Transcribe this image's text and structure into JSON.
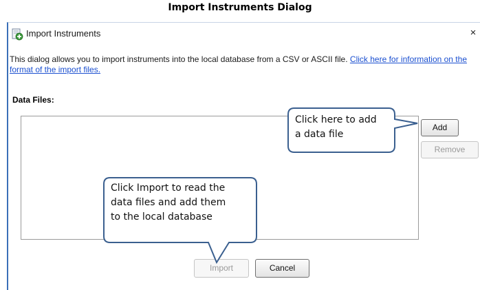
{
  "caption": "Import Instruments Dialog",
  "dialog": {
    "title": "Import Instruments",
    "close_glyph": "×",
    "description": "This dialog allows you to import instruments into the local database from a CSV or ASCII file.",
    "format_link": "Click here for information on the format of the import files.",
    "data_files_label": "Data Files:",
    "buttons": {
      "add": "Add",
      "remove": "Remove",
      "import": "Import",
      "cancel": "Cancel"
    }
  },
  "callouts": {
    "add_line1": "Click here to add",
    "add_line2": "a data file",
    "import_line1": "Click Import to read the",
    "import_line2": "data files and add them",
    "import_line3": "to the local database"
  },
  "colors": {
    "callout_border": "#3a5f8f",
    "dialog_accent": "#3a6fb8",
    "link": "#1a4fd0"
  },
  "icons": {
    "title": "import-instruments-icon",
    "close": "close-icon"
  }
}
